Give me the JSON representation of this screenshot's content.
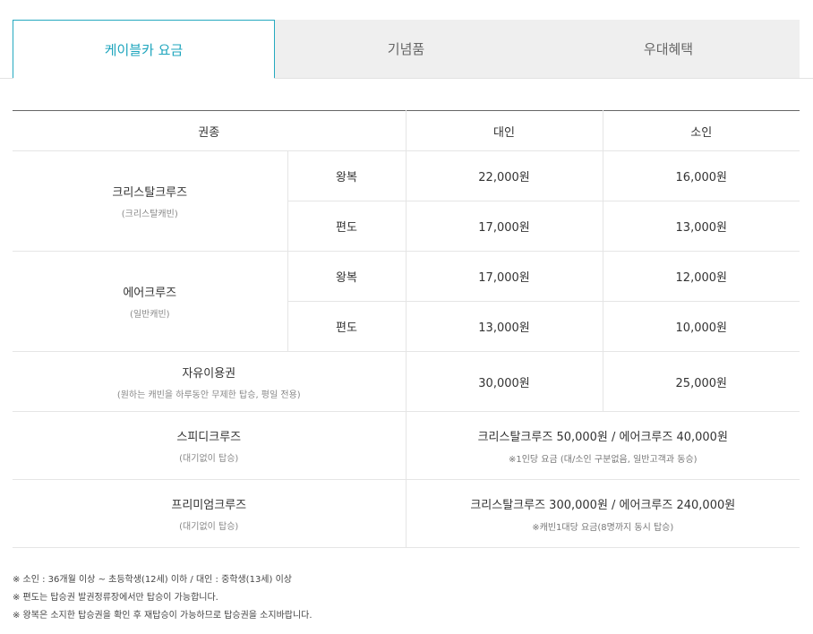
{
  "tabs": [
    {
      "label": "케이블카 요금",
      "active": true
    },
    {
      "label": "기념품",
      "active": false
    },
    {
      "label": "우대혜택",
      "active": false
    }
  ],
  "table": {
    "headers": {
      "type": "권종",
      "adult": "대인",
      "child": "소인"
    },
    "crystal": {
      "name": "크리스탈크루즈",
      "sub": "(크리스탈캐빈)",
      "round": {
        "label": "왕복",
        "adult": "22,000원",
        "child": "16,000원"
      },
      "oneway": {
        "label": "편도",
        "adult": "17,000원",
        "child": "13,000원"
      }
    },
    "air": {
      "name": "에어크루즈",
      "sub": "(일반캐빈)",
      "round": {
        "label": "왕복",
        "adult": "17,000원",
        "child": "12,000원"
      },
      "oneway": {
        "label": "편도",
        "adult": "13,000원",
        "child": "10,000원"
      }
    },
    "free": {
      "name": "자유이용권",
      "sub": "(원하는 캐빈을 하루동안 무제한 탑승, 평일 전용)",
      "adult": "30,000원",
      "child": "25,000원"
    },
    "speedy": {
      "name": "스피디크루즈",
      "sub": "(대기없이 탑승)",
      "price": "크리스탈크루즈 50,000원 / 에어크루즈 40,000원",
      "note": "※1인당 요금 (대/소인 구분없음, 일반고객과 동승)"
    },
    "premium": {
      "name": "프리미엄크루즈",
      "sub": "(대기없이 탑승)",
      "price": "크리스탈크루즈 300,000원 / 에어크루즈 240,000원",
      "note": "※캐빈1대당 요금(8명까지 동시 탑승)"
    }
  },
  "footnotes": [
    "※ 소인 : 36개월 이상 ~ 초등학생(12세) 이하 / 대인 : 중학생(13세) 이상",
    "※ 편도는 탑승권 발권정류장에서만 탑승이 가능합니다.",
    "※ 왕복은 소지한 탑승권을 확인 후 재탑승이 가능하므로 탑승권을 소지바랍니다."
  ]
}
